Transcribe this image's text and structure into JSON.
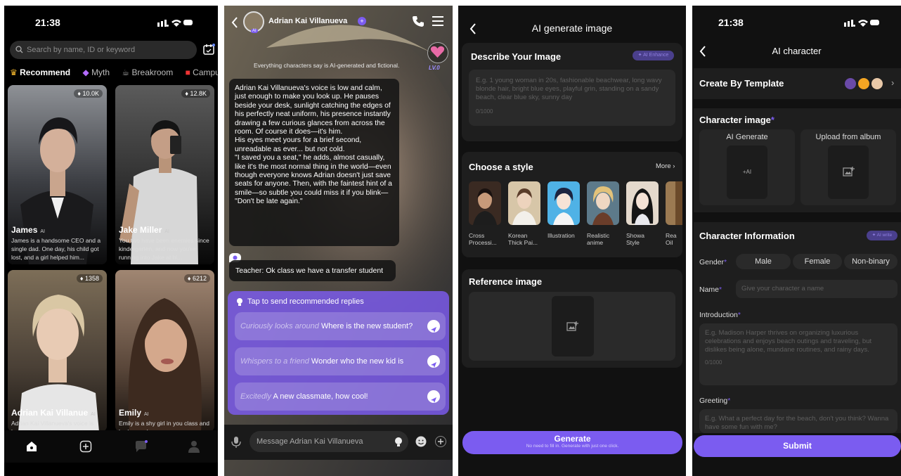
{
  "panel1": {
    "status_time": "21:38",
    "search_placeholder": "Search by name, ID or keyword",
    "categories": [
      {
        "label": "Recommend",
        "icon": "crown-icon"
      },
      {
        "label": "Myth",
        "icon": "gem-icon"
      },
      {
        "label": "Breakroom",
        "icon": "coffee-icon"
      },
      {
        "label": "Campu",
        "icon": "book-icon"
      }
    ],
    "cards": [
      {
        "name": "James",
        "tag": "AI",
        "likes": "10.0K",
        "desc": "James is a handsome CEO and a single dad. One day, his child got lost, and a girl helped him..."
      },
      {
        "name": "Jake Miller",
        "tag": "AI",
        "likes": "12.8K",
        "desc": "You two have been enemies since kindergarten, and now you're running into Jake at hi..."
      },
      {
        "name": "Adrian Kai Villanue",
        "tag": "AI",
        "likes": "1358",
        "desc": "Adrian Kai Villanueva's voice is low and calm, just enough to"
      },
      {
        "name": "Emily",
        "tag": "AI",
        "likes": "6212",
        "desc": "Emily is a shy girl in you class and had a crush on you. you"
      }
    ],
    "nav": [
      "home-icon",
      "add-icon",
      "chat-icon",
      "profile-icon"
    ]
  },
  "panel2": {
    "char_name": "Adrian Kai Villanueva",
    "disclaimer": "Everything characters say is AI-generated and fictional.",
    "level": "LV.0",
    "narration": "Adrian Kai Villanueva's voice is low and calm, just enough to make you look up. He pauses beside your desk, sunlight catching the edges of his perfectly neat uniform, his presence instantly drawing a few curious glances from across the room. Of course it does—it's him.\nHis eyes meet yours for a brief second, unreadable as ever... but not cold.\n\"I saved you a seat,\" he adds, almost casually, like it's the most normal thing in the world—even though everyone knows Adrian doesn't just save seats for anyone. Then, with the faintest hint of a smile—so subtle you could miss it if you blink—\n\"Don't be late again.\"",
    "teacher_msg": "Teacher: Ok class we have a transfer student",
    "rec_title": "Tap to send recommended replies",
    "replies": [
      {
        "action": "Curiously looks around",
        "text": "Where is the new student?"
      },
      {
        "action": "Whispers to a friend",
        "text": "Wonder who the new kid is"
      },
      {
        "action": "Excitedly",
        "text": "A new classmate, how cool!"
      }
    ],
    "input_placeholder": "Message Adrian Kai Villanueva",
    "ai_badge": "AI"
  },
  "panel3": {
    "title": "AI generate image",
    "describe_title": "Describe Your Image",
    "enhance_label": "AI Enhance",
    "describe_placeholder": "E.g. 1 young woman in 20s, fashionable beachwear, long wavy blonde hair, bright blue eyes, playful grin, standing on a sandy beach, clear blue sky, sunny day",
    "counter": "0/1000",
    "style_title": "Choose a style",
    "more_label": "More",
    "styles": [
      {
        "label": "Cross Processi..."
      },
      {
        "label": "Korean Thick Pai..."
      },
      {
        "label": "Illustration"
      },
      {
        "label": "Realistic anime"
      },
      {
        "label": "Showa Style"
      },
      {
        "label": "Rea Oil"
      }
    ],
    "ref_title": "Reference image",
    "generate_label": "Generate",
    "generate_sub": "No need to fill in. Generate with just one click."
  },
  "panel4": {
    "status_time": "21:38",
    "title": "AI character",
    "template_label": "Create By Template",
    "image_title": "Character image",
    "ai_generate_label": "AI Generate",
    "ai_tag": "+AI",
    "upload_label": "Upload from album",
    "info_title": "Character Information",
    "ai_write": "AI write",
    "gender_label": "Gender",
    "genders": [
      "Male",
      "Female",
      "Non-binary"
    ],
    "name_label": "Name",
    "name_placeholder": "Give your character a name",
    "intro_label": "Introduction",
    "intro_placeholder": "E.g. Madison Harper thrives on organizing luxurious celebrations and enjoys beach outings and traveling, but dislikes being alone, mundane routines, and rainy days.",
    "intro_counter": "0/1000",
    "greeting_label": "Greeting",
    "greeting_placeholder": "E.g. What a perfect day for the beach, don't you think? Wanna have some fun with me?",
    "submit_label": "Submit"
  },
  "colors": {
    "accent": "#7b5cf0",
    "background": "#000000",
    "card": "#1e1e1e"
  }
}
